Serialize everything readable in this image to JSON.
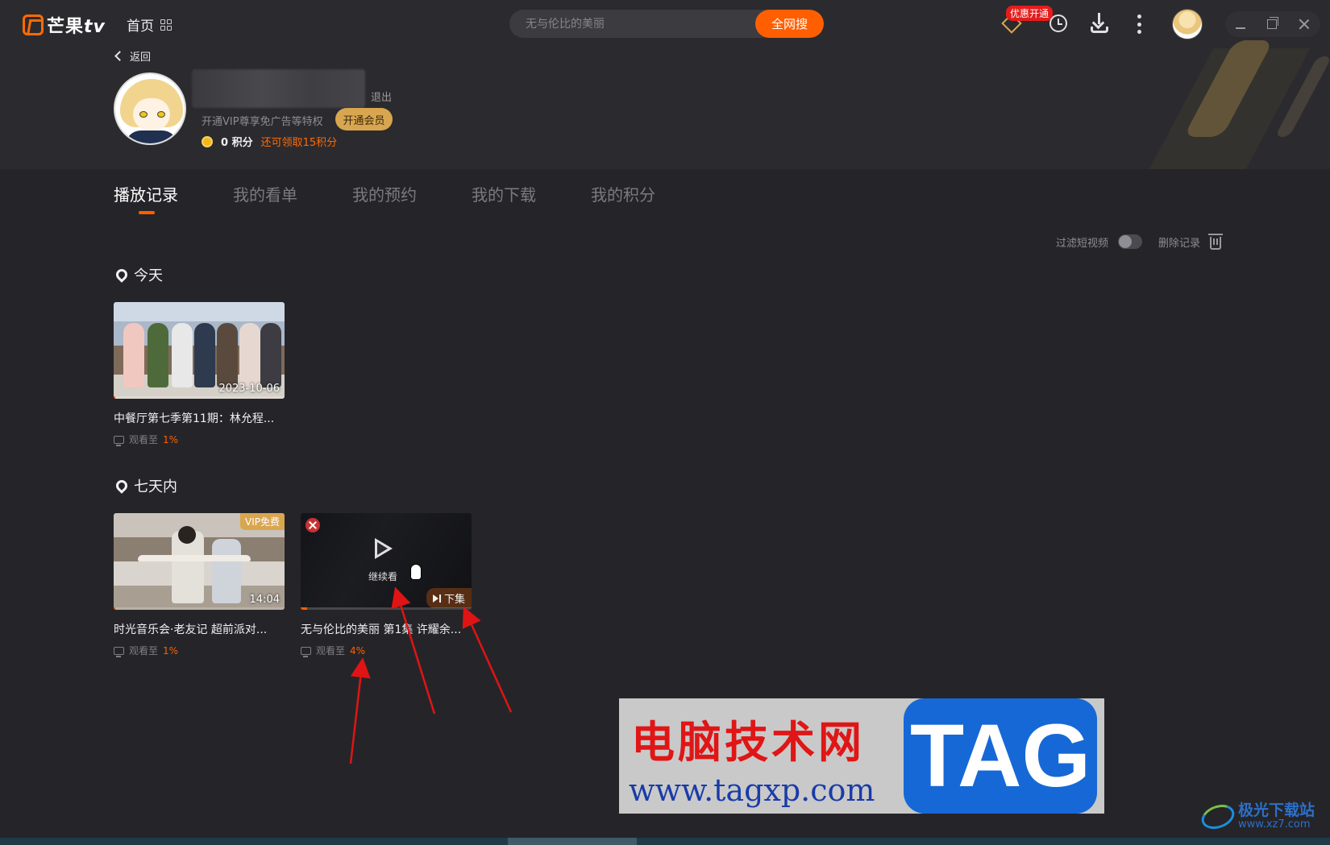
{
  "header": {
    "logo_text": "芒果",
    "logo_tv": "tv",
    "home_label": "首页",
    "search_placeholder": "无与伦比的美丽",
    "search_button": "全网搜",
    "vip_badge": "优惠开通"
  },
  "profile": {
    "back_label": "返回",
    "logout_label": "退出",
    "vip_promo": "开通VIP尊享免广告等特权",
    "vip_button": "开通会员",
    "points": "0 积分",
    "claim_points": "还可领取15积分"
  },
  "tabs": [
    {
      "label": "播放记录",
      "active": true
    },
    {
      "label": "我的看单",
      "active": false
    },
    {
      "label": "我的预约",
      "active": false
    },
    {
      "label": "我的下载",
      "active": false
    },
    {
      "label": "我的积分",
      "active": false
    }
  ],
  "toolbar": {
    "filter_label": "过滤短视频",
    "filter_enabled": false,
    "delete_label": "删除记录"
  },
  "sections": [
    {
      "title": "今天",
      "items": [
        {
          "title": "中餐厅第七季第11期：林允程...",
          "badge": "2023-10-06",
          "watched_label": "观看至",
          "progress": "1%"
        }
      ]
    },
    {
      "title": "七天内",
      "items": [
        {
          "title": "时光音乐会·老友记 超前派对...",
          "badge": "14:04",
          "vip_tag": "VIP免费",
          "watched_label": "观看至",
          "progress": "1%"
        },
        {
          "title": "无与伦比的美丽 第1集 许耀余...",
          "continue_label": "继续看",
          "next_label": "下集",
          "watched_label": "观看至",
          "progress": "4%"
        }
      ]
    }
  ],
  "watermark": {
    "cn": "电脑技术网",
    "url": "www.tagxp.com",
    "tag": "TAG",
    "site2_cn": "极光下载站",
    "site2_url": "www.xz7.com"
  },
  "colors": {
    "accent": "#ff5f00",
    "vip_gold": "#d9a650",
    "background": "#252529",
    "arrow": "#e01414"
  }
}
